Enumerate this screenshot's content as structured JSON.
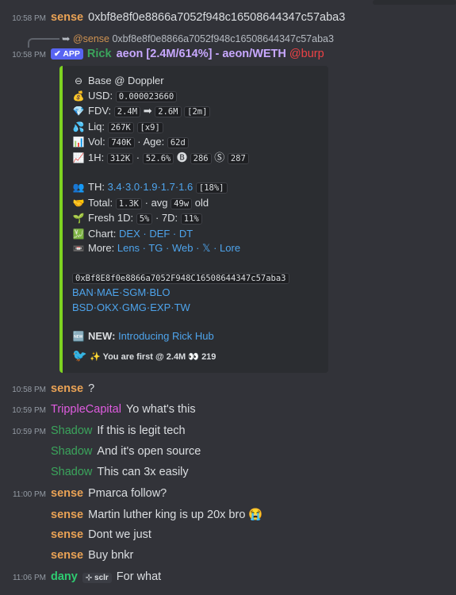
{
  "messages": [
    {
      "time": "10:58 PM",
      "author": "sense",
      "text": "0xbf8e8f0e8866a7052f948c16508644347c57aba3"
    },
    {
      "reply_to": "@sense",
      "reply_text": "0xbf8e8f0e8866a7052f948c16508644347c57aba3"
    },
    {
      "time": "10:58 PM",
      "badge": "✔ APP",
      "author": "Rick",
      "title": "aeon [2.4M/614%] - aeon/WETH",
      "mention": "@burp"
    }
  ],
  "embed": {
    "chain": "Base @ Doppler",
    "usd_label": "USD:",
    "usd": "0.000023660",
    "fdv_label": "FDV:",
    "fdv_from": "2.4M",
    "fdv_arrow": "➡",
    "fdv_to": "2.6M",
    "fdv_time": "[2m]",
    "liq_label": "Liq:",
    "liq": "267K",
    "liq_mult": "[x9]",
    "vol_label": "Vol:",
    "vol": "740K",
    "age_label": "· Age:",
    "age": "62d",
    "h1_label": "1H:",
    "h1_vol": "312K",
    "h1_dot": "·",
    "h1_pct": "52.6%",
    "h1_buys": "286",
    "h1_sells": "287",
    "th_label": "TH:",
    "th_values": "3.4·3.0·1.9·1.7·1.6",
    "th_pct": "[18%]",
    "total_label": "Total:",
    "total": "1.3K",
    "avg_label": "· avg",
    "avg": "49w",
    "avg_suffix": "old",
    "fresh_label": "Fresh 1D:",
    "fresh_1d": "5%",
    "fresh_7d_label": "· 7D:",
    "fresh_7d": "11%",
    "chart_label": "Chart:",
    "chart_links": "DEX · DEF · DT",
    "more_label": "More:",
    "more_links": "Lens · TG · Web · 𝕏 · Lore",
    "address": "0xBf8E8f0e8866a7052F948C16508644347c57aba3",
    "bots_1": "BAN·MAE·SGM·BLO",
    "bots_2": "BSD·OKX·GMG·EXP·TW",
    "new_label": "NEW:",
    "new_link": "Introducing Rick Hub",
    "footer": "You are first @ 2.4M",
    "footer_count": "219"
  },
  "chat": [
    {
      "time": "10:58 PM",
      "author": "sense",
      "text": "?"
    },
    {
      "time": "10:59 PM",
      "author": "TrippleCapital",
      "text": "Yo what's this"
    },
    {
      "time": "10:59 PM",
      "author": "Shadow",
      "text": "If this is legit tech"
    },
    {
      "time": "",
      "author": "Shadow",
      "text": "And it's open source"
    },
    {
      "time": "",
      "author": "Shadow",
      "text": "This can 3x easily"
    },
    {
      "time": "11:00 PM",
      "author": "sense",
      "text": "Pmarca follow?"
    },
    {
      "time": "",
      "author": "sense",
      "text": "Martin luther king is up 20x bro 😭"
    },
    {
      "time": "",
      "author": "sense",
      "text": "Dont we just"
    },
    {
      "time": "",
      "author": "sense",
      "text": "Buy bnkr"
    },
    {
      "time": "11:06 PM",
      "author": "dany",
      "tag": "⊹ sclr",
      "text": "For what"
    }
  ],
  "colors": {
    "background": "#323339",
    "embed_bar": "#7ed321",
    "link": "#4ea4ec",
    "app_badge": "#5865f2"
  }
}
